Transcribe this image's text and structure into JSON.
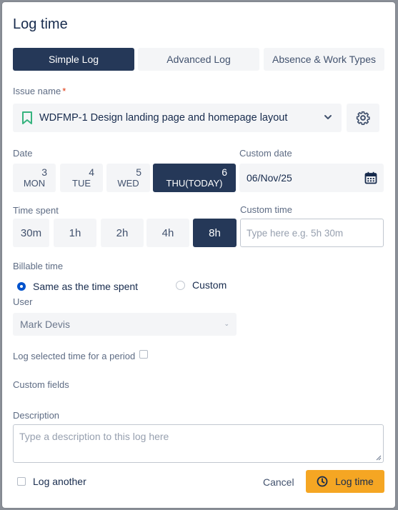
{
  "dialog": {
    "title": "Log time"
  },
  "tabs": [
    {
      "label": "Simple Log",
      "active": true
    },
    {
      "label": "Advanced Log",
      "active": false
    },
    {
      "label": "Absence & Work Types",
      "active": false
    }
  ],
  "issue": {
    "label": "Issue name",
    "required_mark": "*",
    "value": "WDFMP-1 Design landing page and homepage layout",
    "icon": "bookmark-icon"
  },
  "date": {
    "label": "Date",
    "days": [
      {
        "num": "3",
        "name": "MON",
        "active": false
      },
      {
        "num": "4",
        "name": "TUE",
        "active": false
      },
      {
        "num": "5",
        "name": "WED",
        "active": false
      },
      {
        "num": "6",
        "name": "THU(TODAY)",
        "active": true
      }
    ],
    "custom_label": "Custom date",
    "custom_value": "06/Nov/25"
  },
  "time_spent": {
    "label": "Time spent",
    "options": [
      "30m",
      "1h",
      "2h",
      "4h",
      "8h"
    ],
    "selected": "8h",
    "custom_label": "Custom time",
    "custom_placeholder": "Type here e.g. 5h 30m"
  },
  "billable": {
    "label": "Billable time",
    "same_option": "Same as the time spent",
    "custom_option": "Custom",
    "selected": "same"
  },
  "user": {
    "label": "User",
    "value": "Mark Devis"
  },
  "period": {
    "label": "Log selected time for a period",
    "checked": false
  },
  "custom_fields": {
    "label": "Custom fields"
  },
  "description": {
    "label": "Description",
    "placeholder": "Type a description to this log here"
  },
  "footer": {
    "log_another": "Log another",
    "cancel": "Cancel",
    "submit": "Log time"
  },
  "colors": {
    "primary_dark": "#253858",
    "accent": "#f5a623",
    "radio_blue": "#0052cc",
    "bookmark_green": "#36b37e"
  }
}
